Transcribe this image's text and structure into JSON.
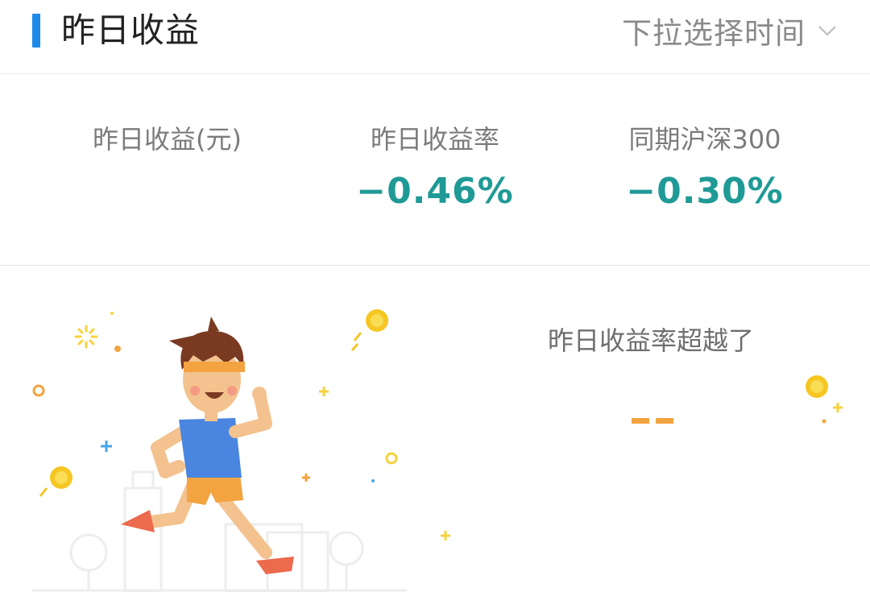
{
  "header": {
    "title": "昨日收益",
    "time_picker_label": "下拉选择时间",
    "accent_color": "#1e8be8"
  },
  "stats": [
    {
      "label": "昨日收益(元)",
      "value": ""
    },
    {
      "label": "昨日收益率",
      "value": "−0.46%"
    },
    {
      "label": "同期沪深300",
      "value": "−0.30%"
    }
  ],
  "value_color": "#1f9a96",
  "ranking": {
    "title": "昨日收益率超越了",
    "value": "--",
    "value_color": "#f3a340"
  },
  "icons": {
    "dropdown": "chevron-down-icon",
    "runner": "runner-illustration",
    "coin": "coin-icon"
  }
}
